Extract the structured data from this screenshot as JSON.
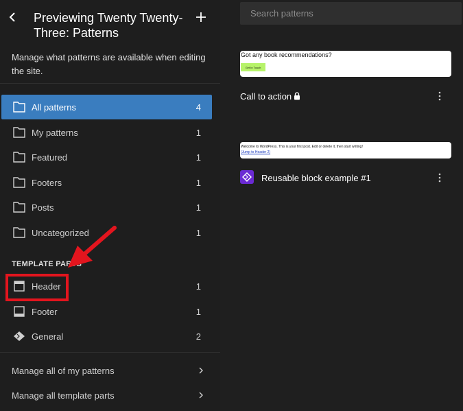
{
  "sidebar": {
    "title": "Previewing Twenty Twenty-Three: Patterns",
    "description": "Manage what patterns are available when editing the site.",
    "categories": [
      {
        "label": "All patterns",
        "count": "4"
      },
      {
        "label": "My patterns",
        "count": "1"
      },
      {
        "label": "Featured",
        "count": "1"
      },
      {
        "label": "Footers",
        "count": "1"
      },
      {
        "label": "Posts",
        "count": "1"
      },
      {
        "label": "Uncategorized",
        "count": "1"
      }
    ],
    "template_parts_heading": "TEMPLATE PARTS",
    "template_parts": [
      {
        "label": "Header",
        "count": "1",
        "icon": "header-layout-icon"
      },
      {
        "label": "Footer",
        "count": "1",
        "icon": "footer-layout-icon"
      },
      {
        "label": "General",
        "count": "2",
        "icon": "block-diamond-icon"
      }
    ],
    "footer_links": [
      {
        "label": "Manage all of my patterns"
      },
      {
        "label": "Manage all template parts"
      }
    ]
  },
  "main": {
    "search_placeholder": "Search patterns",
    "patterns": [
      {
        "title": "Call to action",
        "preview_heading": "Got any book recommendations?",
        "preview_button": "Get In Touch",
        "preview_button_color": "#b7f36a"
      },
      {
        "title": "Reusable block example #1",
        "preview_line1": "Welcome to WordPress. This is your first post. Edit or delete it, then start writing!",
        "preview_line2": "(Jump to Header 2)",
        "badge_color": "#6a2ad3"
      }
    ]
  },
  "colors": {
    "accent": "#3a7dbf",
    "annotation": "#e3151e",
    "background": "#1e1e1e"
  }
}
